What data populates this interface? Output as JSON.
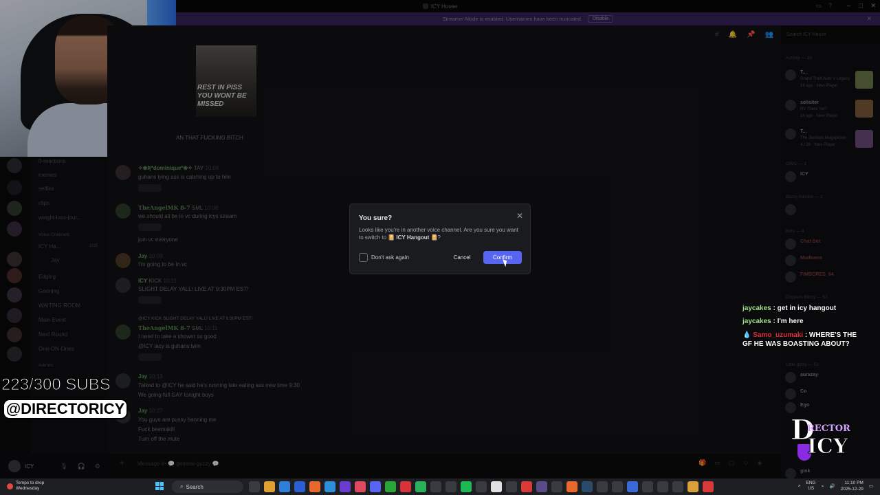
{
  "window": {
    "title": "ICY House"
  },
  "banner": {
    "text": "Streamer Mode is enabled. Usernames have been truncated.",
    "button": "Disable"
  },
  "search": {
    "placeholder": "Search ICY House"
  },
  "channels": [
    "0-reactions",
    "memes",
    "selfies",
    "clips",
    "weight-loss-jour...",
    "Voice Channels",
    "ICY Ha...",
    "Jay",
    "Edging",
    "Gooning",
    "WAITING ROOM",
    "Main Event",
    "Next Round",
    "One-ON-Ones",
    "Admins"
  ],
  "voice_count": "1/15",
  "user": {
    "name": "ICY"
  },
  "image_caption": "REST IN PISS YOU WONT BE MISSED",
  "messages": [
    {
      "name": "",
      "time": "",
      "text": "AN THAT FUCKING BITCH"
    },
    {
      "name": "✧❀Ʀ*dominique*❀✧",
      "tag": "TAY",
      "time": "10:08",
      "text": "guhans lying ass is catching up to him"
    },
    {
      "name": "TheAngelMK 8-7",
      "tag": "SML",
      "time": "10:08",
      "text": "we should all be in vc during icys stream"
    },
    {
      "name": "",
      "time": "",
      "text": "join vc everyone"
    },
    {
      "name": "Jay",
      "time": "10:09",
      "text": "I'm going to be in vc"
    },
    {
      "name": "ICY",
      "tag": "KICK",
      "time": "10:11",
      "text": "SLIGHT DELAY YALL! LIVE AT 9:30PM EST!"
    },
    {
      "name": "TheAngelMK 8-7",
      "tag": "SML",
      "time": "10:11",
      "reply": "@ICY KICK SLIGHT DELAY YALL! LIVE AT 9:30PM EST!",
      "text": "I need to take a shower so good"
    },
    {
      "name": "",
      "time": "",
      "text": "@ICY lacy is guhans twin"
    },
    {
      "name": "Jay",
      "time": "10:13",
      "text": "Talked to @ICY he said he's running late eating ass new time 9:30"
    },
    {
      "name": "",
      "time": "",
      "text": "We going full GAY tonight boys"
    },
    {
      "name": "Jay",
      "time": "10:27",
      "text": "You guys are pussy banning me"
    },
    {
      "name": "",
      "time": "",
      "text": "Fuck beemskill"
    },
    {
      "name": "",
      "time": "",
      "text": "Turn off the mute"
    }
  ],
  "message_input": {
    "placeholder": "Message #• 💬 general-guzzy 💬"
  },
  "members": {
    "activity_header": "Activity — 10",
    "activity": [
      {
        "name": "T...",
        "game": "Grand Theft Auto V Legacy",
        "meta": "16 ago · New Player"
      },
      {
        "name": "solisiter",
        "game": "RV There Yet?",
        "meta": "1h ago · New Player"
      },
      {
        "name": "T...",
        "game": "The Jackbox Megapicker",
        "meta": "4 / 28 · New Player"
      }
    ],
    "owner_header": "OWO — 1",
    "owner": "ICY",
    "admins_header": "Blizzy Admins — 1",
    "bots_header": "Bots — 4",
    "bots": [
      "Chat Bot",
      "Mudkwns",
      "FIMBORES_64"
    ],
    "members_header": "Drippers Blizzy — 52",
    "bottom_header": "Little gizzy — 52",
    "bottom": [
      "aurazay",
      "Co",
      "Ego",
      "gink"
    ]
  },
  "modal": {
    "title": "You sure?",
    "body_prefix": "Looks like you're in another voice channel. Are you sure you want to switch to",
    "channel": "📔 ICY Hangout 📔",
    "body_suffix": "?",
    "checkbox_label": "Don't ask again",
    "cancel": "Cancel",
    "confirm": "Confirm"
  },
  "overlay": {
    "subs": "223/300 SUBS",
    "handle": "@DIRECTORICY",
    "chat": [
      {
        "user": "jaycakes",
        "msg": ": get in icy hangout"
      },
      {
        "user": "jaycakes",
        "msg": ": I'm here"
      },
      {
        "user": "Samo_uzumaki",
        "msg": ": WHERE'S THE GF HE WAS BOASTING ABOUT?"
      }
    ],
    "logo_big": "D",
    "logo_dir": "RECTOR",
    "logo_icy": "ICY"
  },
  "taskbar": {
    "weather_title": "Temps to drop",
    "weather_day": "Wednesday",
    "search": "Search",
    "lang1": "ENG",
    "lang2": "US",
    "time": "11:10 PM",
    "date": "2025-12-29"
  },
  "colors": {
    "accent": "#5865f2",
    "banner": "#35235a",
    "twitch_user": "#a6e38f",
    "twitch_user2": "#e0303a"
  }
}
